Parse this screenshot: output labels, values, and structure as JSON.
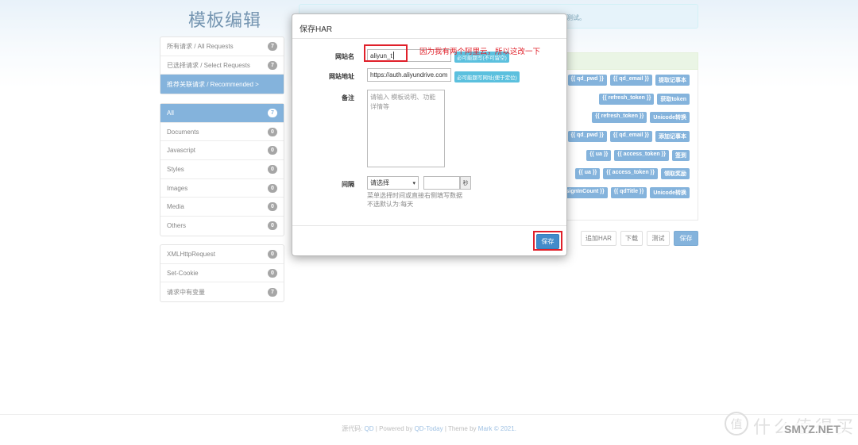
{
  "page": {
    "title": "模板编辑"
  },
  "alert": {
    "text": "测试。"
  },
  "requests_menu": [
    {
      "label": "所有请求 / All Requests",
      "count": "7"
    },
    {
      "label": "已选择请求 / Select Requests",
      "count": "7"
    },
    {
      "label": "推荐关联请求 / Recommended >",
      "count": ""
    }
  ],
  "type_filters": [
    {
      "label": "All",
      "count": "7"
    },
    {
      "label": "Documents",
      "count": "0"
    },
    {
      "label": "Javascript",
      "count": "0"
    },
    {
      "label": "Styles",
      "count": "0"
    },
    {
      "label": "Images",
      "count": "0"
    },
    {
      "label": "Media",
      "count": "0"
    },
    {
      "label": "Others",
      "count": "0"
    }
  ],
  "extra_filters": [
    {
      "label": "XMLHttpRequest",
      "count": "0"
    },
    {
      "label": "Set-Cookie",
      "count": "0"
    },
    {
      "label": "请求中有变量",
      "count": "7"
    }
  ],
  "variable_rows": [
    [
      "{{ qd_pwd }}",
      "{{ qd_email }}",
      "提取记事本"
    ],
    [
      "{{ refresh_token }}",
      "获取token"
    ],
    [
      "{{ refresh_token }}",
      "Unicode转换"
    ],
    [
      "{{ qd_pwd }}",
      "{{ qd_email }}",
      "添加记事本"
    ],
    [
      "{{ ua }}",
      "{{ access_token }}",
      "签到"
    ],
    [
      "{{ ua }}",
      "{{ access_token }}",
      "领取奖励"
    ],
    [
      "{{ signInCount }}",
      "{{ qdTitle }}",
      "Unicode转换"
    ]
  ],
  "toolbar": {
    "add_har": "追加HAR",
    "download": "下载",
    "test": "测试",
    "save": "保存"
  },
  "modal": {
    "title": "保存HAR",
    "site_name_label": "网站名",
    "site_name_value": "aliyun_t",
    "site_name_help": "必可能题写(不可留空)",
    "site_url_label": "网站地址",
    "site_url_value": "https://auth.aliyundrive.com",
    "site_url_help": "必可能题写网址(便于定位)",
    "note_label": "备注",
    "note_placeholder": "请输入 模板说明、功能详情等",
    "interval_label": "间隔",
    "interval_select": "请选择",
    "interval_unit": "秒",
    "interval_hint_1": "菜单选择时间或直接右侧填写数据",
    "interval_hint_2": "不选默认为:每天",
    "save_button": "保存"
  },
  "annotation": {
    "text": "因为我有两个阿里云，所以这改一下"
  },
  "footer": {
    "prefix": "源代码:",
    "link_1": "QD",
    "sep_1": "| Powered by",
    "link_2": "QD-Today",
    "sep_2": "| Theme by",
    "author": "Mark © 2021."
  },
  "watermark": {
    "icon_char": "值",
    "text": "什么值得买",
    "site": "SMYZ.NET"
  },
  "colors": {
    "primary": "#428bca",
    "annotation_red": "#e0202a",
    "info": "#5bc0de"
  }
}
